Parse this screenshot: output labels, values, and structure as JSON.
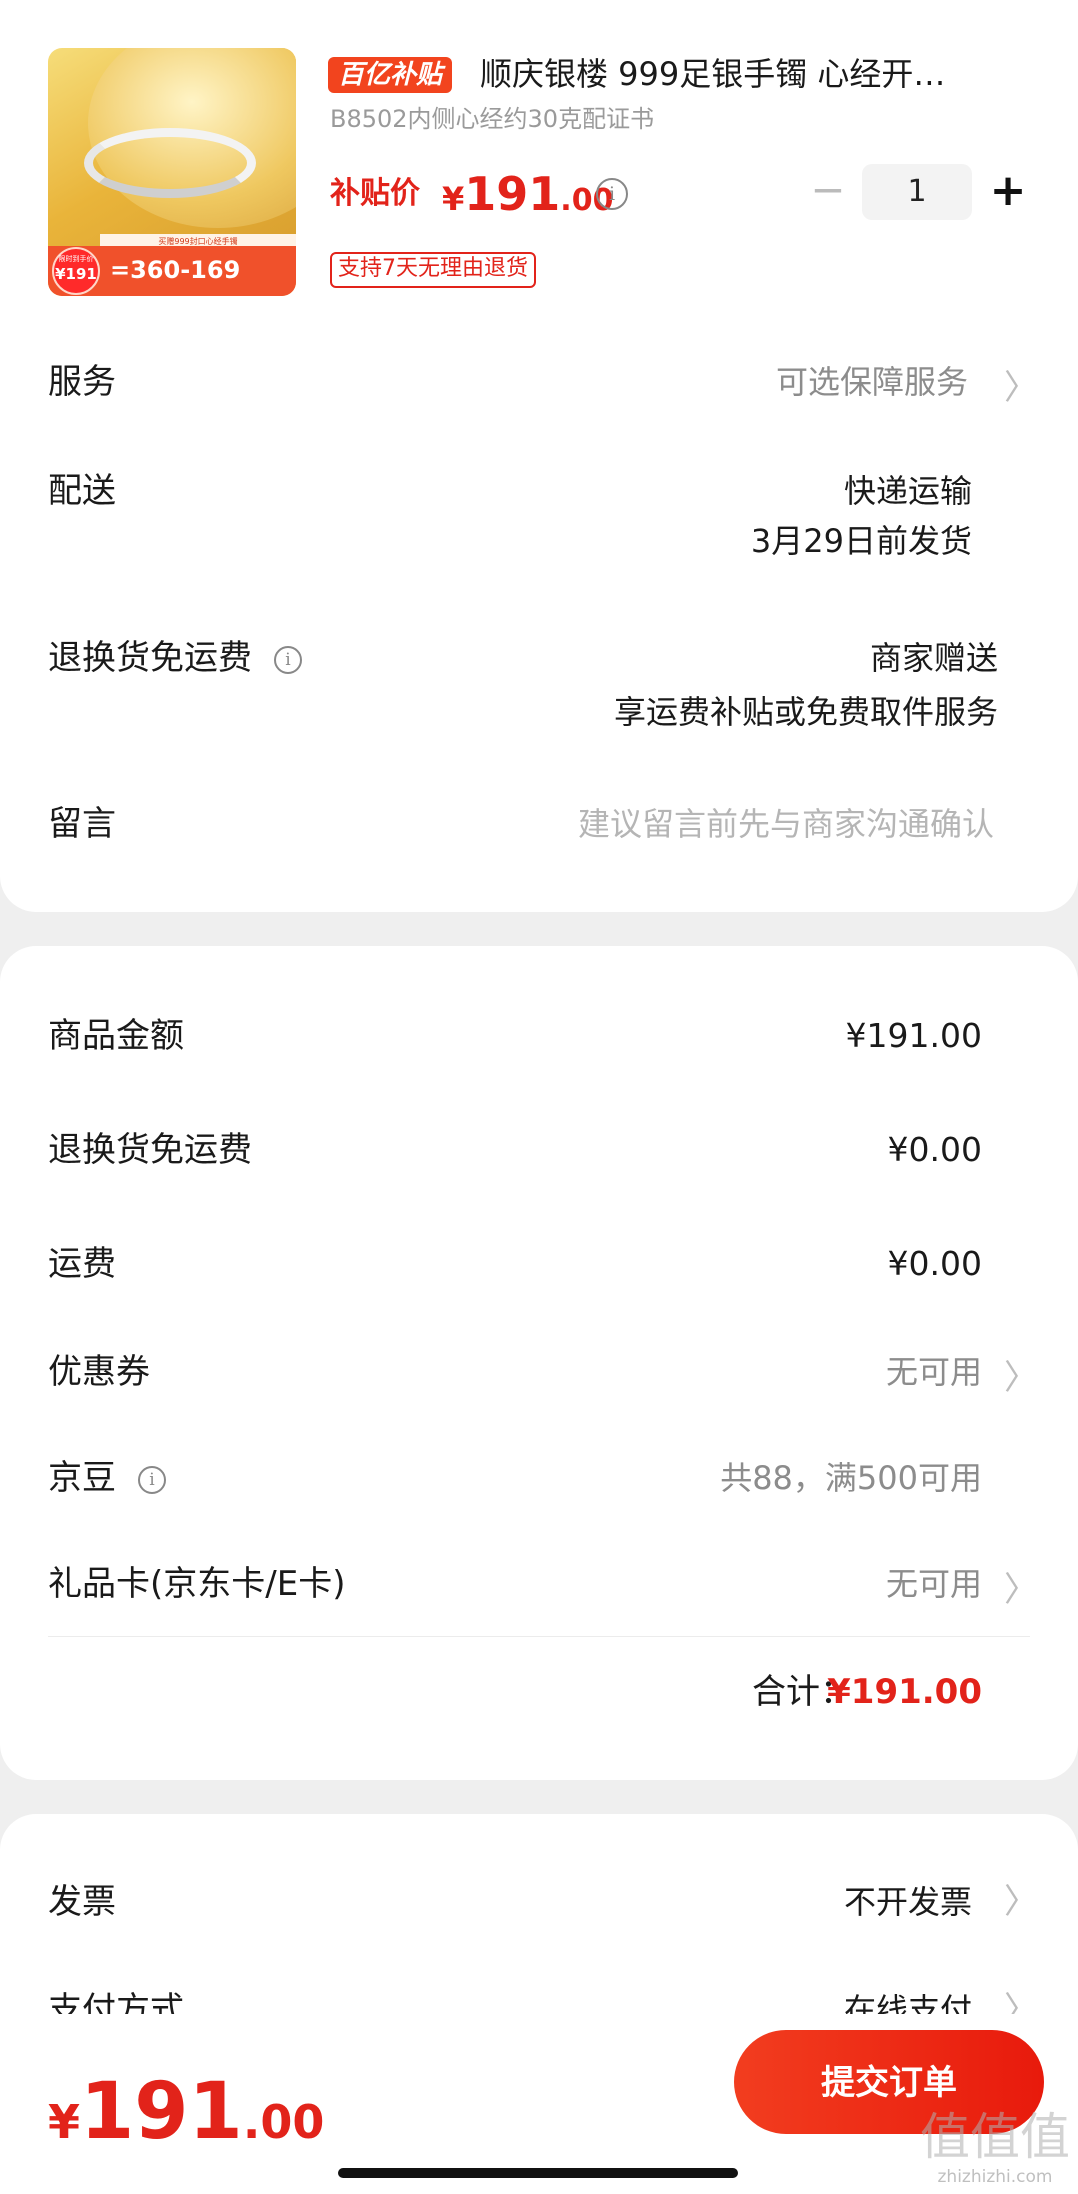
{
  "product": {
    "badge": "百亿补贴",
    "title": "顺庆银楼 999足银手镯 心经开…",
    "spec": "B8502内侧心经约30克配证书",
    "price_label": "补贴价",
    "price_currency": "¥",
    "price_int": "191",
    "price_dec": ".00",
    "quantity": "1",
    "return_tag": "支持7天无理由退货",
    "thumb": {
      "strip_text": "买赠999封口心经手镯",
      "bubble_label": "限时到手价",
      "bubble_value": "¥191",
      "formula": "=360-169"
    }
  },
  "rows": {
    "service": {
      "label": "服务",
      "value": "可选保障服务"
    },
    "delivery": {
      "label": "配送",
      "value_line1": "快递运输",
      "value_line2": "3月29日前发货"
    },
    "return_freight": {
      "label": "退换货免运费",
      "value_line1": "商家赠送",
      "value_line2": "享运费补贴或免费取件服务"
    },
    "message": {
      "label": "留言",
      "placeholder": "建议留言前先与商家沟通确认"
    }
  },
  "summary": {
    "goods_amount": {
      "label": "商品金额",
      "value": "¥191.00"
    },
    "return_freight": {
      "label": "退换货免运费",
      "value": "¥0.00"
    },
    "shipping": {
      "label": "运费",
      "value": "¥0.00"
    },
    "coupon": {
      "label": "优惠券",
      "value": "无可用"
    },
    "jd_beans": {
      "label": "京豆",
      "value": "共88，满500可用"
    },
    "gift_card": {
      "label": "礼品卡(京东卡/E卡)",
      "value": "无可用"
    },
    "total_label": "合计：",
    "total_value": "¥191.00"
  },
  "invoice": {
    "invoice": {
      "label": "发票",
      "value": "不开发票"
    },
    "payment": {
      "label": "支付方式",
      "value": "在线支付"
    }
  },
  "bottom": {
    "currency": "¥",
    "price_int": "191",
    "price_dec": ".00",
    "submit_label": "提交订单",
    "watermark_text": "值值值",
    "watermark_url": "zhizhizhi.com"
  },
  "icons": {
    "info": "i",
    "chevron": "〉"
  },
  "colors": {
    "accent": "#e2231a",
    "button": "#f23d1f",
    "background": "#efefef"
  }
}
